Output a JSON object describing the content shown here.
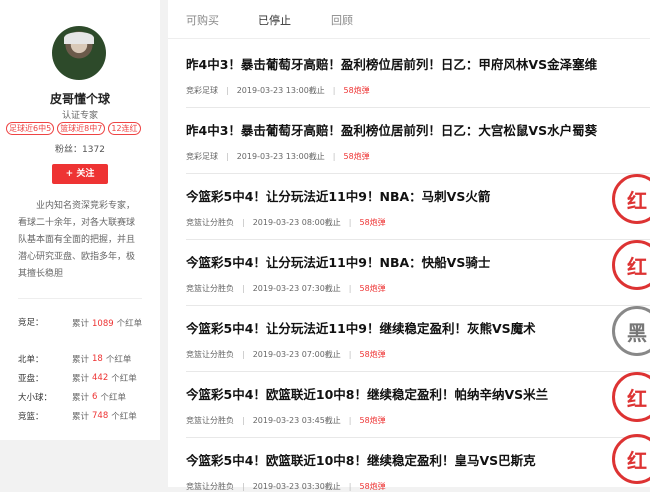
{
  "profile": {
    "name": "皮哥懂个球",
    "certification": "认证专家",
    "tags": [
      "足球近6中5",
      "篮球近8中7",
      "12连红"
    ],
    "fans": "粉丝：1372",
    "follow_label": "+ 关注",
    "bio": "业内知名资深竞彩专家，看球二十余年，对各大联赛球队基本面有全面的把握，并且潜心研究亚盘、欧指多年，极其擅长稳胆"
  },
  "stats": [
    {
      "label": "竞足：",
      "prefix": "累计",
      "count": "1089",
      "suffix": "个红单"
    },
    {
      "label": "北单：",
      "prefix": "累计",
      "count": "18",
      "suffix": "个红单"
    },
    {
      "label": "亚盘：",
      "prefix": "累计",
      "count": "442",
      "suffix": "个红单"
    },
    {
      "label": "大小球：",
      "prefix": "累计",
      "count": "6",
      "suffix": "个红单"
    },
    {
      "label": "竞篮：",
      "prefix": "累计",
      "count": "748",
      "suffix": "个红单"
    }
  ],
  "tabs": [
    "可购买",
    "已停止",
    "回顾"
  ],
  "articles": [
    {
      "title": "昨4中3！暴击葡萄牙高赔！盈利榜位居前列！日乙：甲府风林VS金泽塞维",
      "category": "竞彩足球",
      "time": "2019-03-23 13:00截止",
      "price": "58炮弹",
      "stamp": ""
    },
    {
      "title": "昨4中3！暴击葡萄牙高赔！盈利榜位居前列！日乙：大宫松鼠VS水户蜀葵",
      "category": "竞彩足球",
      "time": "2019-03-23 13:00截止",
      "price": "58炮弹",
      "stamp": ""
    },
    {
      "title": "今篮彩5中4！让分玩法近11中9！NBA：马刺VS火箭",
      "category": "竞篮让分胜负",
      "time": "2019-03-23 08:00截止",
      "price": "58炮弹",
      "stamp": "红"
    },
    {
      "title": "今篮彩5中4！让分玩法近11中9！NBA：快船VS骑士",
      "category": "竞篮让分胜负",
      "time": "2019-03-23 07:30截止",
      "price": "58炮弹",
      "stamp": "红"
    },
    {
      "title": "今篮彩5中4！让分玩法近11中9！继续稳定盈利！灰熊VS魔术",
      "category": "竞篮让分胜负",
      "time": "2019-03-23 07:00截止",
      "price": "58炮弹",
      "stamp": "黑"
    },
    {
      "title": "今篮彩5中4！欧篮联近10中8！继续稳定盈利！帕纳辛纳VS米兰",
      "category": "竞篮让分胜负",
      "time": "2019-03-23 03:45截止",
      "price": "58炮弹",
      "stamp": "红"
    },
    {
      "title": "今篮彩5中4！欧篮联近10中8！继续稳定盈利！皇马VS巴斯克",
      "category": "竞篮让分胜负",
      "time": "2019-03-23 03:30截止",
      "price": "58炮弹",
      "stamp": "红"
    }
  ]
}
